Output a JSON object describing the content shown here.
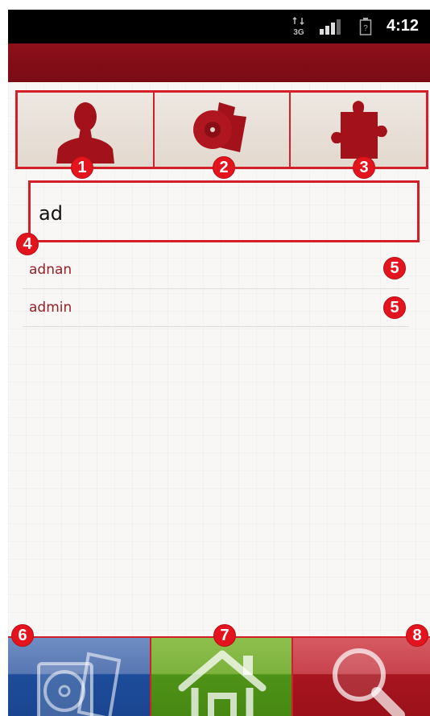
{
  "status_bar": {
    "network_label": "3G",
    "time": "4:12"
  },
  "tabs": [
    {
      "id": "users",
      "icon": "person-icon",
      "marker": "1"
    },
    {
      "id": "media",
      "icon": "media-disc-icon",
      "marker": "2"
    },
    {
      "id": "plugins",
      "icon": "puzzle-piece-icon",
      "marker": "3"
    }
  ],
  "search": {
    "value": "ad",
    "marker": "4"
  },
  "results": [
    {
      "label": "adnan",
      "marker": "5"
    },
    {
      "label": "admin",
      "marker": "5"
    }
  ],
  "bottom_nav": [
    {
      "id": "media",
      "icon": "disc-case-icon",
      "marker": "6"
    },
    {
      "id": "home",
      "icon": "house-icon",
      "marker": "7"
    },
    {
      "id": "search",
      "icon": "magnifier-icon",
      "marker": "8"
    }
  ],
  "colors": {
    "brand_red": "#8d101a",
    "marker_red": "#e3141d",
    "media_blue": "#1d4c9a",
    "home_green": "#4f9218",
    "search_red": "#a81620"
  }
}
